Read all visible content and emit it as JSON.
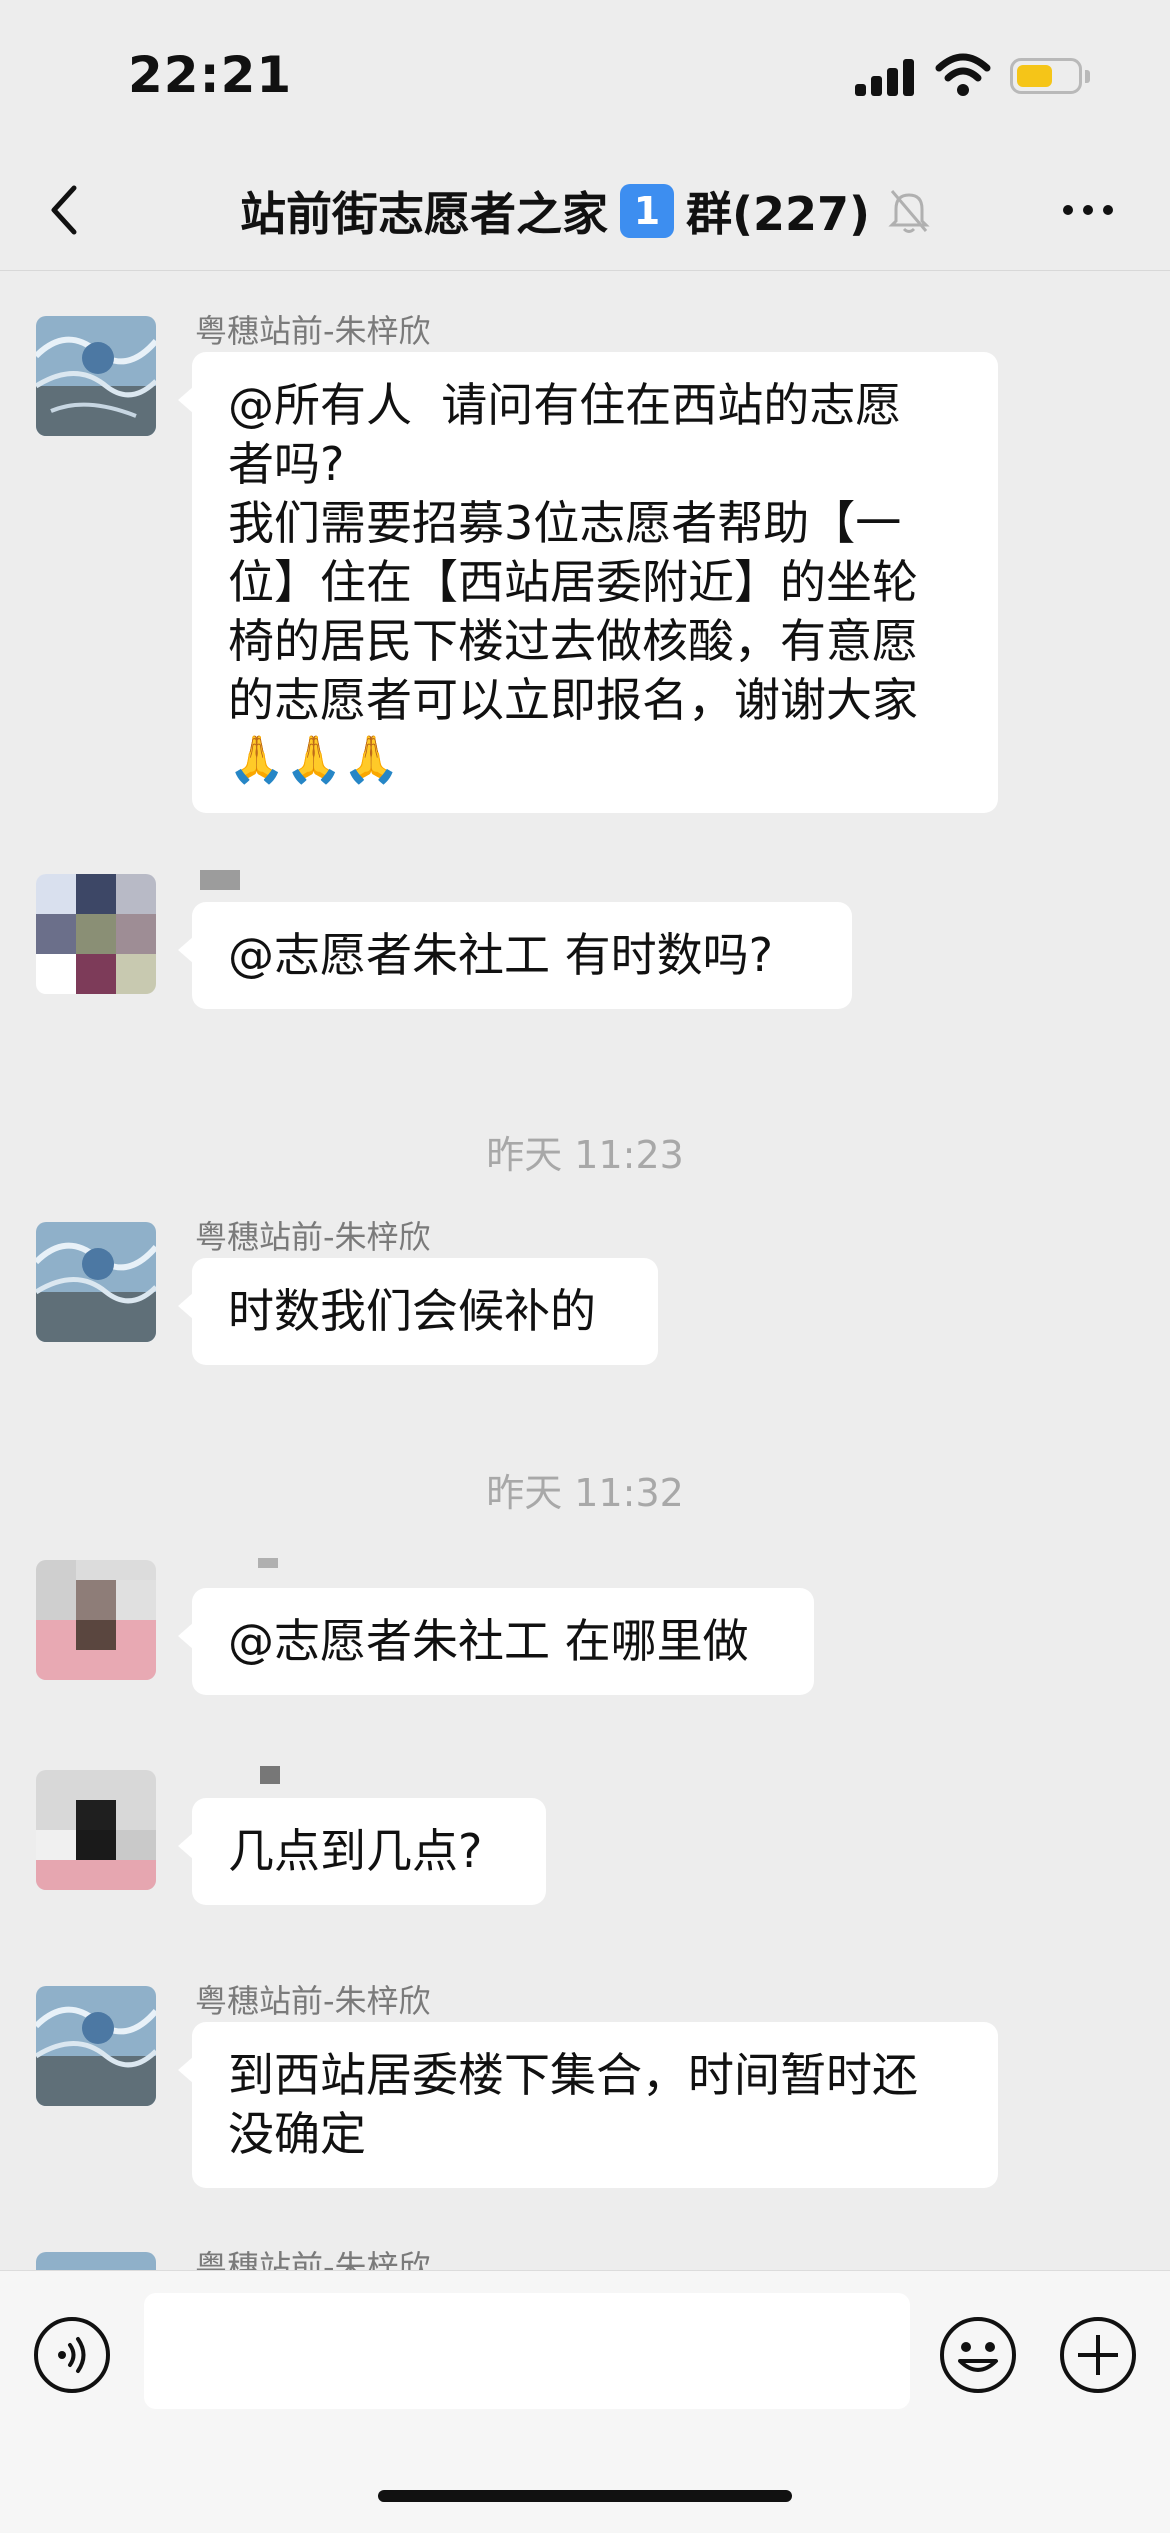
{
  "status_bar": {
    "time": "22:21",
    "battery_level": 0.6,
    "battery_color": "#f5c518"
  },
  "header": {
    "title": "站前街志愿者之家",
    "badge_number": "1",
    "suffix": "群(227)",
    "icons": [
      "back-icon",
      "mute-bell-icon",
      "more-icon"
    ]
  },
  "messages": [
    {
      "sender": "粤穗站前-朱梓欣",
      "text": "@所有人  请问有住在西站的志愿\n者吗?\n我们需要招募3位志愿者帮助【一\n位】住在【西站居委附近】的坐轮\n椅的居民下楼过去做核酸，有意愿\n的志愿者可以立即报名，谢谢大家\n🙏🙏🙏"
    },
    {
      "sender": "",
      "text": "@志愿者朱社工 有时数吗?"
    },
    {
      "timestamp": "昨天 11:23"
    },
    {
      "sender": "粤穗站前-朱梓欣",
      "text": "时数我们会候补的"
    },
    {
      "timestamp": "昨天 11:32"
    },
    {
      "sender": "",
      "text": "@志愿者朱社工 在哪里做"
    },
    {
      "sender": "",
      "text": "几点到几点?"
    },
    {
      "sender": "粤穗站前-朱梓欣",
      "text": "到西站居委楼下集合，时间暂时还\n没确定"
    },
    {
      "sender": "粤穗站前-朱梓欣"
    }
  ],
  "input_bar": {
    "value": "",
    "icons": [
      "voice-icon",
      "emoji-icon",
      "plus-icon"
    ]
  },
  "colors": {
    "background": "#ededed",
    "bubble": "#ffffff",
    "badge": "#3d8ef0",
    "timestamp": "#a8a8a8"
  }
}
